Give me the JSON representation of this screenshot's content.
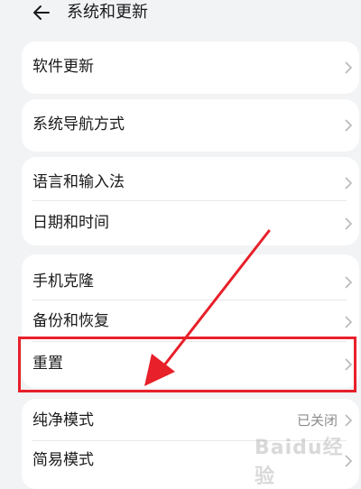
{
  "header": {
    "title": "系统和更新",
    "back_icon": "arrow-left-icon"
  },
  "groups": [
    {
      "items": [
        {
          "label": "软件更新"
        }
      ]
    },
    {
      "items": [
        {
          "label": "系统导航方式"
        }
      ]
    },
    {
      "items": [
        {
          "label": "语言和输入法"
        },
        {
          "label": "日期和时间"
        }
      ]
    },
    {
      "items": [
        {
          "label": "手机克隆"
        },
        {
          "label": "备份和恢复"
        },
        {
          "label": "重置"
        }
      ]
    },
    {
      "items": [
        {
          "label": "纯净模式",
          "value": "已关闭"
        },
        {
          "label": "简易模式"
        }
      ]
    }
  ],
  "annotation": {
    "highlight_color": "#e8202a",
    "target": "重置"
  },
  "watermark": {
    "text": "Baidu经验"
  }
}
